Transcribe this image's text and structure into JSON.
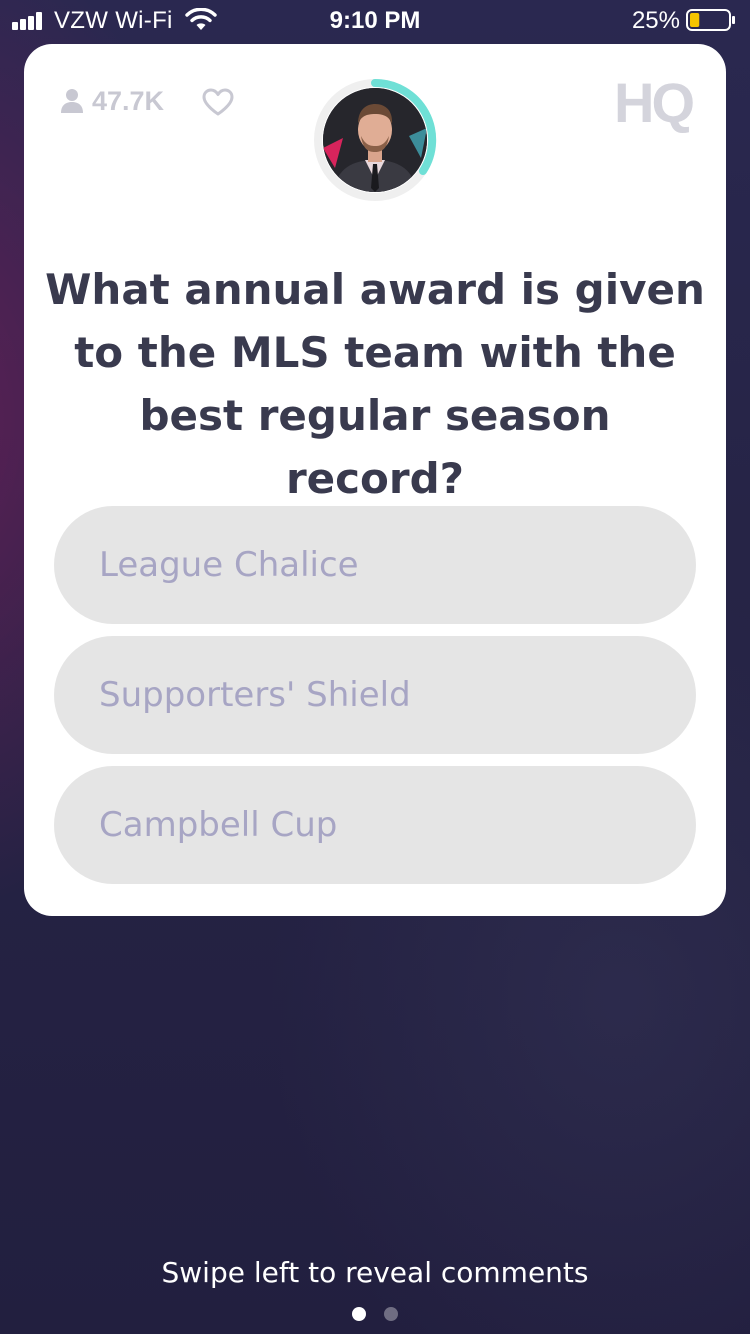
{
  "status_bar": {
    "carrier": "VZW Wi-Fi",
    "time": "9:10 PM",
    "battery_percent": "25%",
    "battery_level": 0.25,
    "battery_color": "#f5c400",
    "signal_icon": "cellular-signal-icon",
    "wifi_icon": "wifi-icon"
  },
  "header": {
    "viewer_count": "47.7K",
    "viewer_icon": "person-icon",
    "heart_icon": "heart-icon",
    "host_icon": "host-avatar",
    "timer_color": "#6fe0d6",
    "logo": "HQ"
  },
  "question": {
    "text": "What annual award is given to the MLS team with the best regular season record?"
  },
  "answers": [
    {
      "label": "League Chalice"
    },
    {
      "label": "Supporters' Shield"
    },
    {
      "label": "Campbell Cup"
    }
  ],
  "footer": {
    "swipe_hint": "Swipe left to reveal comments",
    "page_count": 2,
    "active_page": 1
  }
}
